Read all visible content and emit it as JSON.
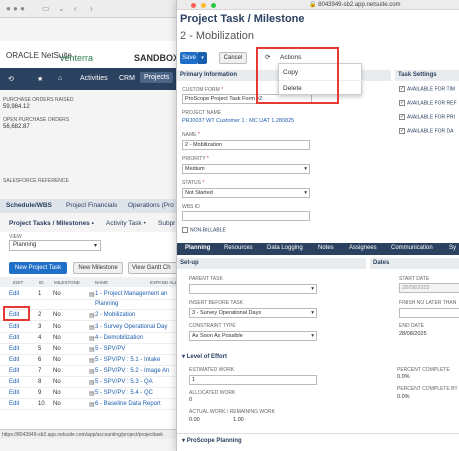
{
  "background": {
    "brand_left": "ORACLE NetSuite",
    "brand_logo": "venterra",
    "sandbox_label": "SANDBOX",
    "nav": [
      "Activities",
      "CRM",
      "Projects"
    ],
    "info": [
      {
        "label": "PURCHASE ORDERS RAISED",
        "value": "59,984.12"
      },
      {
        "label": "OPEN PURCHASE ORDERS",
        "value": "56,682.87"
      },
      {
        "label": "SALESFORCE REFERENCE",
        "value": ""
      }
    ],
    "tabs": [
      "Schedule/WBS",
      "Project Financials",
      "Operations (Pro"
    ],
    "subtabs": [
      "Project Tasks / Milestones •",
      "Activity Task •",
      "Subpr"
    ],
    "view_label": "VIEW",
    "view_value": "Planning",
    "buttons": {
      "new_task": "New Project Task",
      "new_milestone": "New Milestone",
      "gantt": "View Gantt Ch"
    },
    "columns": [
      "EDIT",
      "ID",
      "MILESTONE",
      "NAME",
      "EXPAND ALL"
    ],
    "rows": [
      {
        "edit": "Edit",
        "id": "1",
        "ms": "No",
        "name": "1 - Project Management an"
      },
      {
        "edit": "",
        "id": "",
        "ms": "",
        "name": "Planning"
      },
      {
        "edit": "Edit",
        "id": "2",
        "ms": "No",
        "name": "2 - Mobilization"
      },
      {
        "edit": "Edit",
        "id": "3",
        "ms": "No",
        "name": "3 - Survey Operational Day"
      },
      {
        "edit": "Edit",
        "id": "4",
        "ms": "No",
        "name": "4 - Demobilization"
      },
      {
        "edit": "Edit",
        "id": "5",
        "ms": "No",
        "name": "5 - SPV/PV"
      },
      {
        "edit": "Edit",
        "id": "6",
        "ms": "No",
        "name": "5 - SPV/PV : 5.1 - Intake"
      },
      {
        "edit": "Edit",
        "id": "7",
        "ms": "No",
        "name": "5 - SPV/PV : 5.2 - Image An"
      },
      {
        "edit": "Edit",
        "id": "8",
        "ms": "No",
        "name": "5 - SPV/PV : 5.3 - QA"
      },
      {
        "edit": "Edit",
        "id": "9",
        "ms": "No",
        "name": "5 - SPV/PV : 5.4 - QC"
      },
      {
        "edit": "Edit",
        "id": "10",
        "ms": "No",
        "name": "6 - Baseline Data Report"
      }
    ],
    "status_url": "https://8043949-sb2.app.netsuite.com/app/accounting/project/projecttask"
  },
  "popup": {
    "url": "8043949-sb2.app.netsuite.com",
    "title": "Project Task / Milestone",
    "subtitle": "2 - Mobilization",
    "save": "Save",
    "cancel": "Cancel",
    "actions": "Actions",
    "menu": [
      "Copy",
      "Delete"
    ],
    "primary_info": "Primary Information",
    "task_settings": "Task Settings",
    "fields": {
      "custom_form_label": "CUSTOM FORM",
      "custom_form_value": "ProScope Project Task Form v2",
      "project_name_label": "PROJECT NAME",
      "project_name_value": "PRJ0037 WT Customer 1 : MC UAT 1.280825",
      "name_label": "NAME",
      "name_value": "2 - Mobilization",
      "priority_label": "PRIORITY",
      "priority_value": "Medium",
      "status_label": "STATUS",
      "status_value": "Not Started",
      "wbs_label": "WBS ID",
      "non_billable": "NON-BILLABLE"
    },
    "task_settings_items": [
      "AVAILABLE FOR TIM",
      "AVAILABLE FOR REF",
      "AVAILABLE FOR PRI",
      "AVAILABLE FOR DA"
    ],
    "tabs": [
      "Planning",
      "Resources",
      "Data Logging",
      "Notes",
      "Assignees",
      "Communication",
      "Sy"
    ],
    "setup": "Set-up",
    "dates": "Dates",
    "parent_task_label": "PARENT TASK",
    "insert_before_label": "INSERT BEFORE TASK",
    "insert_before_value": "3 - Survey Operational Days",
    "constraint_label": "CONSTRAINT TYPE",
    "constraint_value": "As Soon As Possible",
    "start_date_label": "START DATE",
    "start_date_value": "28/08/2025",
    "finish_no_later_label": "FINISH NO LATER THAN",
    "end_date_label": "END DATE",
    "end_date_value": "28/08/2025",
    "level_of_effort": "Level of Effort",
    "estimated_work_label": "ESTIMATED WORK",
    "estimated_work_value": "1",
    "allocated_work_label": "ALLOCATED WORK",
    "allocated_work_value": "0",
    "actual_work_label": "ACTUAL WORK",
    "remaining_work_label": "/ REMAINING WORK",
    "actual_work_value": "0.00",
    "remaining_work_value": "1.00",
    "percent_complete_label": "PERCENT COMPLETE",
    "percent_complete_value": "0.0%",
    "percent_complete_by_label": "PERCENT COMPLETE BY",
    "percent_complete_by_value": "0.0%",
    "proscope_planning": "ProScope Planning"
  },
  "colors": {
    "nav": "#2b4160",
    "accent": "#1f6fc8",
    "highlight": "#e53935"
  }
}
